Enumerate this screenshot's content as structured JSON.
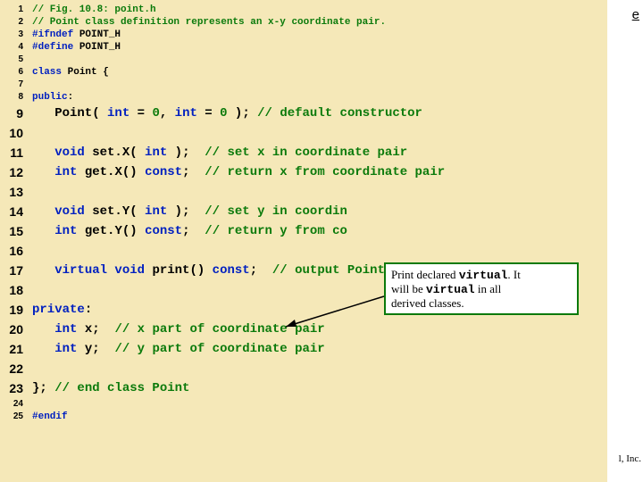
{
  "lines": [
    {
      "n": "1",
      "size": "small",
      "tokens": [
        {
          "cls": "c-comment",
          "t": "// Fig. 10.8: point.h"
        }
      ]
    },
    {
      "n": "2",
      "size": "small",
      "tokens": [
        {
          "cls": "c-comment",
          "t": "// Point class definition represents an x-y coordinate pair."
        }
      ]
    },
    {
      "n": "3",
      "size": "small",
      "tokens": [
        {
          "cls": "c-pre",
          "t": "#ifndef "
        },
        {
          "cls": "c-ident",
          "t": "POINT_H"
        }
      ]
    },
    {
      "n": "4",
      "size": "small",
      "tokens": [
        {
          "cls": "c-pre",
          "t": "#define "
        },
        {
          "cls": "c-ident",
          "t": "POINT_H"
        }
      ]
    },
    {
      "n": "5",
      "size": "small",
      "tokens": [
        {
          "cls": "",
          "t": " "
        }
      ]
    },
    {
      "n": "6",
      "size": "small",
      "tokens": [
        {
          "cls": "c-keyword",
          "t": "class"
        },
        {
          "cls": "",
          "t": " Point {"
        }
      ]
    },
    {
      "n": "7",
      "size": "small",
      "tokens": [
        {
          "cls": "",
          "t": " "
        }
      ]
    },
    {
      "n": "8",
      "size": "small",
      "tokens": [
        {
          "cls": "c-keyword",
          "t": "public"
        },
        {
          "cls": "",
          "t": ":"
        }
      ]
    },
    {
      "n": "9",
      "size": "big",
      "tokens": [
        {
          "cls": "",
          "t": "   Point( "
        },
        {
          "cls": "c-keyword",
          "t": "int"
        },
        {
          "cls": "",
          "t": " = "
        },
        {
          "cls": "c-num",
          "t": "0"
        },
        {
          "cls": "",
          "t": ", "
        },
        {
          "cls": "c-keyword",
          "t": "int"
        },
        {
          "cls": "",
          "t": " = "
        },
        {
          "cls": "c-num",
          "t": "0"
        },
        {
          "cls": "",
          "t": " ); "
        },
        {
          "cls": "c-comment",
          "t": "// default constructor"
        }
      ]
    },
    {
      "n": "10",
      "size": "big",
      "tokens": [
        {
          "cls": "",
          "t": " "
        }
      ]
    },
    {
      "n": "11",
      "size": "big",
      "tokens": [
        {
          "cls": "",
          "t": "   "
        },
        {
          "cls": "c-keyword",
          "t": "void"
        },
        {
          "cls": "",
          "t": " set.X( "
        },
        {
          "cls": "c-keyword",
          "t": "int"
        },
        {
          "cls": "",
          "t": " );  "
        },
        {
          "cls": "c-comment",
          "t": "// set x in coordinate pair"
        }
      ]
    },
    {
      "n": "12",
      "size": "big",
      "tokens": [
        {
          "cls": "",
          "t": "   "
        },
        {
          "cls": "c-keyword",
          "t": "int"
        },
        {
          "cls": "",
          "t": " get.X() "
        },
        {
          "cls": "c-keyword",
          "t": "const"
        },
        {
          "cls": "",
          "t": ";  "
        },
        {
          "cls": "c-comment",
          "t": "// return x from coordinate pair"
        }
      ]
    },
    {
      "n": "13",
      "size": "big",
      "tokens": [
        {
          "cls": "",
          "t": " "
        }
      ]
    },
    {
      "n": "14",
      "size": "big",
      "tokens": [
        {
          "cls": "",
          "t": "   "
        },
        {
          "cls": "c-keyword",
          "t": "void"
        },
        {
          "cls": "",
          "t": " set.Y( "
        },
        {
          "cls": "c-keyword",
          "t": "int"
        },
        {
          "cls": "",
          "t": " );  "
        },
        {
          "cls": "c-comment",
          "t": "// set y in coordin"
        }
      ]
    },
    {
      "n": "15",
      "size": "big",
      "tokens": [
        {
          "cls": "",
          "t": "   "
        },
        {
          "cls": "c-keyword",
          "t": "int"
        },
        {
          "cls": "",
          "t": " get.Y() "
        },
        {
          "cls": "c-keyword",
          "t": "const"
        },
        {
          "cls": "",
          "t": ";  "
        },
        {
          "cls": "c-comment",
          "t": "// return y from co"
        }
      ]
    },
    {
      "n": "16",
      "size": "big",
      "tokens": [
        {
          "cls": "",
          "t": " "
        }
      ]
    },
    {
      "n": "17",
      "size": "big",
      "tokens": [
        {
          "cls": "",
          "t": "   "
        },
        {
          "cls": "c-keyword",
          "t": "virtual void"
        },
        {
          "cls": "",
          "t": " print() "
        },
        {
          "cls": "c-keyword",
          "t": "const"
        },
        {
          "cls": "",
          "t": ";  "
        },
        {
          "cls": "c-comment",
          "t": "// output Point object"
        }
      ]
    },
    {
      "n": "18",
      "size": "big",
      "tokens": [
        {
          "cls": "",
          "t": " "
        }
      ]
    },
    {
      "n": "19",
      "size": "big",
      "tokens": [
        {
          "cls": "c-keyword",
          "t": "private"
        },
        {
          "cls": "",
          "t": ":"
        }
      ]
    },
    {
      "n": "20",
      "size": "big",
      "tokens": [
        {
          "cls": "",
          "t": "   "
        },
        {
          "cls": "c-keyword",
          "t": "int"
        },
        {
          "cls": "",
          "t": " x;  "
        },
        {
          "cls": "c-comment",
          "t": "// x part of coordinate pair"
        }
      ]
    },
    {
      "n": "21",
      "size": "big",
      "tokens": [
        {
          "cls": "",
          "t": "   "
        },
        {
          "cls": "c-keyword",
          "t": "int"
        },
        {
          "cls": "",
          "t": " y;  "
        },
        {
          "cls": "c-comment",
          "t": "// y part of coordinate pair"
        }
      ]
    },
    {
      "n": "22",
      "size": "big",
      "tokens": [
        {
          "cls": "",
          "t": " "
        }
      ]
    },
    {
      "n": "23",
      "size": "big",
      "tokens": [
        {
          "cls": "",
          "t": "}; "
        },
        {
          "cls": "c-comment",
          "t": "// end class Point"
        }
      ]
    },
    {
      "n": "24",
      "size": "small",
      "tokens": [
        {
          "cls": "",
          "t": " "
        }
      ]
    },
    {
      "n": "25",
      "size": "small",
      "tokens": [
        {
          "cls": "c-pre",
          "t": "#endif"
        }
      ]
    }
  ],
  "callout": {
    "line1a": "Print declared ",
    "kw1": "virtual",
    "line1b": ". It",
    "line2a": "will be ",
    "kw2": "virtual",
    "line2b": " in all",
    "line3": "derived classes."
  },
  "edge": {
    "top": "e",
    "bottom": "l, Inc."
  }
}
